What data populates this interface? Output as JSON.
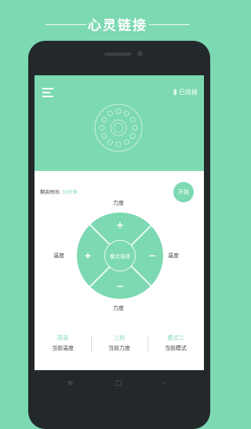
{
  "promo": {
    "title": "心灵链接"
  },
  "header": {
    "bt_status": "已连接",
    "bluetooth_icon": "bluetooth-icon",
    "menu_icon": "menu-icon"
  },
  "session": {
    "remaining_label": "剩余时间:",
    "remaining_value": "30分钟",
    "start_label": "开始"
  },
  "control": {
    "top_label": "力度",
    "bottom_label": "力度",
    "left_label": "温度",
    "right_label": "温度",
    "center_label": "模式选择",
    "plus_top": "+",
    "plus_left": "+",
    "minus_right": "−",
    "minus_bottom": "−"
  },
  "stats": [
    {
      "value": "高温",
      "label": "当前温度"
    },
    {
      "value": "三挡",
      "label": "当前力度"
    },
    {
      "value": "模式二",
      "label": "当前模式"
    }
  ],
  "navbar": {
    "menu": "≡",
    "home": "□",
    "back": "‹"
  },
  "colors": {
    "accent": "#7dd9b1",
    "phone": "#23282b"
  }
}
